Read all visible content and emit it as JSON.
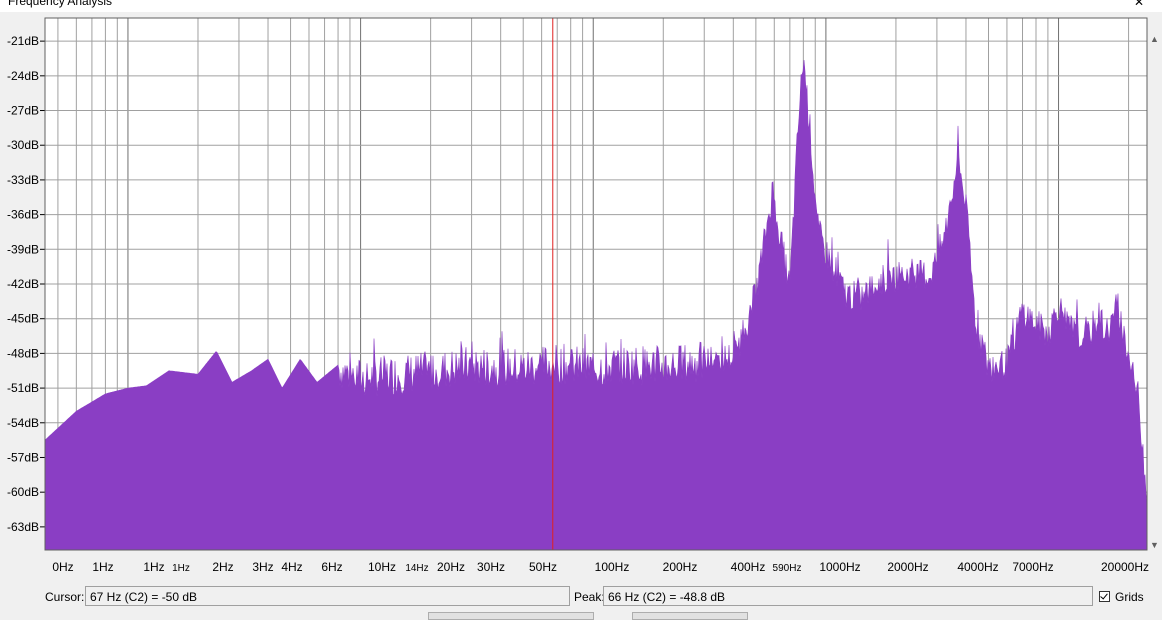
{
  "window": {
    "title": "Frequency Analysis"
  },
  "colors": {
    "spectrum_fill": "#8a3ec4",
    "grid": "#a0a0a0",
    "cursor_line": "#e02020",
    "plot_bg": "#ffffff"
  },
  "icons": {
    "close": "close-icon",
    "scroll_up": "scroll-up-arrow-icon",
    "scroll_down": "scroll-down-arrow-icon",
    "checkbox": "checkbox-checked-icon"
  },
  "status": {
    "cursor_label": "Cursor:",
    "cursor_value": "67 Hz (C2) = -50 dB",
    "peak_label": "Peak:",
    "peak_value": "66 Hz (C2) = -48.8 dB",
    "grids_label": "Grids",
    "grids_checked": true
  },
  "chart_data": {
    "type": "area",
    "xscale": "log",
    "x_tick_labels": [
      "0Hz",
      "1Hz",
      "1Hz",
      "1Hz",
      "2Hz",
      "3Hz",
      "4Hz",
      "6Hz",
      "10Hz",
      "14Hz",
      "20Hz",
      "30Hz",
      "50Hz",
      "100Hz",
      "200Hz",
      "400Hz",
      "590Hz",
      "1000Hz",
      "2000Hz",
      "4000Hz",
      "7000Hz",
      "20000Hz"
    ],
    "y_tick_labels": [
      "-21dB",
      "-24dB",
      "-27dB",
      "-30dB",
      "-33dB",
      "-36dB",
      "-39dB",
      "-42dB",
      "-45dB",
      "-48dB",
      "-51dB",
      "-54dB",
      "-57dB",
      "-60dB",
      "-63dB"
    ],
    "y_ticks": [
      -21,
      -24,
      -27,
      -30,
      -33,
      -36,
      -39,
      -42,
      -45,
      -48,
      -51,
      -54,
      -57,
      -60,
      -63
    ],
    "ylim": [
      -65,
      -19
    ],
    "xlim": [
      0.44,
      24000
    ],
    "cursor_x": 67,
    "series": [
      {
        "points": [
          [
            0.44,
            -55.5
          ],
          [
            0.6,
            -53
          ],
          [
            0.8,
            -51.5
          ],
          [
            1.0,
            -51
          ],
          [
            1.2,
            -50.8
          ],
          [
            1.5,
            -49.5
          ],
          [
            2.0,
            -49.8
          ],
          [
            2.4,
            -47.8
          ],
          [
            2.8,
            -50.5
          ],
          [
            3.4,
            -49.5
          ],
          [
            4.0,
            -48.5
          ],
          [
            4.6,
            -51
          ],
          [
            5.5,
            -48.5
          ],
          [
            6.5,
            -50.5
          ],
          [
            8.0,
            -49
          ],
          [
            10,
            -49.8
          ],
          [
            14,
            -49.5
          ],
          [
            20,
            -49.2
          ],
          [
            30,
            -48.7
          ],
          [
            50,
            -48.9
          ],
          [
            67,
            -48.5
          ],
          [
            100,
            -48.9
          ],
          [
            150,
            -48.6
          ],
          [
            200,
            -48.7
          ],
          [
            300,
            -48.4
          ],
          [
            400,
            -48.0
          ],
          [
            450,
            -45.5
          ],
          [
            500,
            -42.5
          ],
          [
            560,
            -36.5
          ],
          [
            590,
            -33.5
          ],
          [
            640,
            -38
          ],
          [
            700,
            -42
          ],
          [
            760,
            -28
          ],
          [
            800,
            -22
          ],
          [
            860,
            -29
          ],
          [
            920,
            -37
          ],
          [
            1000,
            -39
          ],
          [
            1100,
            -40.5
          ],
          [
            1200,
            -42.5
          ],
          [
            1400,
            -43
          ],
          [
            1700,
            -41.5
          ],
          [
            2000,
            -41
          ],
          [
            2400,
            -40.8
          ],
          [
            2800,
            -41
          ],
          [
            3200,
            -38
          ],
          [
            3500,
            -34
          ],
          [
            3700,
            -30.5
          ],
          [
            4000,
            -35
          ],
          [
            4400,
            -45
          ],
          [
            5000,
            -49
          ],
          [
            6000,
            -48.6
          ],
          [
            7000,
            -44
          ],
          [
            8000,
            -45.2
          ],
          [
            9000,
            -46
          ],
          [
            10000,
            -43.5
          ],
          [
            11000,
            -45.5
          ],
          [
            13000,
            -46.5
          ],
          [
            15000,
            -44.5
          ],
          [
            16000,
            -46
          ],
          [
            18000,
            -43.8
          ],
          [
            20000,
            -48
          ],
          [
            22000,
            -51.5
          ],
          [
            24000,
            -60
          ]
        ]
      }
    ]
  }
}
